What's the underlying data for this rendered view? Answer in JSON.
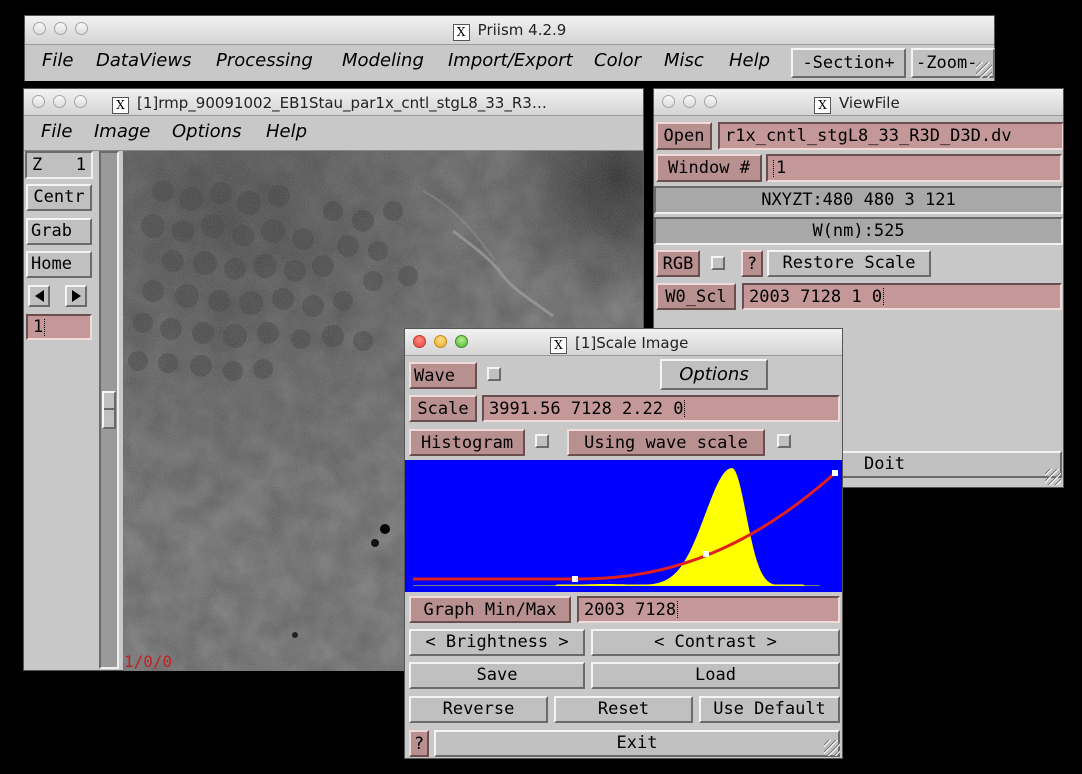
{
  "main_window": {
    "title": "Priism 4.2.9",
    "menu": [
      "File",
      "DataViews",
      "Processing",
      "Modeling",
      "Import/Export",
      "Color",
      "Misc",
      "Help"
    ],
    "section_button": "-Section+",
    "zoom_button": "-Zoom-"
  },
  "image_window": {
    "title": "[1]rmp_90091002_EB1Stau_par1x_cntl_stgL8_33_R3…",
    "menu": [
      "File",
      "Image",
      "Options",
      "Help"
    ],
    "z_label": "Z",
    "z_value": "1",
    "centr": "Centr",
    "grab": "Grab",
    "home": "Home",
    "frame_value": "1",
    "overlay_text": "1/0/0"
  },
  "viewfile_window": {
    "title": "ViewFile",
    "open_label": "Open",
    "open_value": "r1x_cntl_stgL8_33_R3D_D3D.dv",
    "window_label": "Window #",
    "window_value": "1",
    "dims_text": "NXYZT:480 480 3 121",
    "wavelength_text": "W(nm):525",
    "rgb_label": "RGB",
    "help_q": "?",
    "restore_scale": "Restore Scale",
    "w0_label": "W0_Scl",
    "w0_value": "2003 7128 1 0",
    "doit": "Doit"
  },
  "scale_window": {
    "title": "[1]Scale Image",
    "wave_label": "Wave",
    "options": "Options",
    "scale_label": "Scale",
    "scale_value": "3991.56 7128 2.22 0",
    "histogram_label": "Histogram",
    "using_wave_scale": "Using wave scale",
    "graph_minmax_label": "Graph Min/Max",
    "graph_minmax_value": "2003 7128",
    "brightness": "< Brightness >",
    "contrast": "< Contrast >",
    "save": "Save",
    "load": "Load",
    "reverse": "Reverse",
    "reset": "Reset",
    "use_default": "Use Default",
    "help_q": "?",
    "exit": "Exit",
    "colors": {
      "plot_bg": "#0000ff",
      "histogram": "#ffff00",
      "curve": "#e0201e",
      "marker": "#ffffff"
    }
  }
}
